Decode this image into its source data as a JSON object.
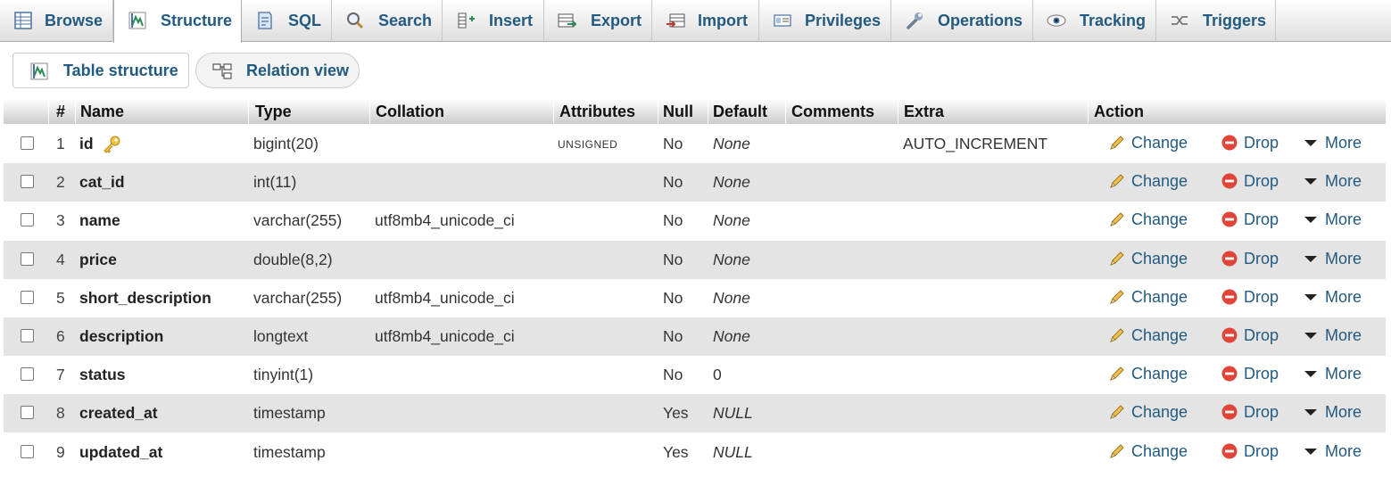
{
  "tabs": [
    {
      "id": "browse",
      "label": "Browse",
      "icon": "browse-icon"
    },
    {
      "id": "structure",
      "label": "Structure",
      "icon": "structure-icon",
      "active": true
    },
    {
      "id": "sql",
      "label": "SQL",
      "icon": "sql-icon"
    },
    {
      "id": "search",
      "label": "Search",
      "icon": "search-icon"
    },
    {
      "id": "insert",
      "label": "Insert",
      "icon": "insert-icon"
    },
    {
      "id": "export",
      "label": "Export",
      "icon": "export-icon"
    },
    {
      "id": "import",
      "label": "Import",
      "icon": "import-icon"
    },
    {
      "id": "privileges",
      "label": "Privileges",
      "icon": "privileges-icon"
    },
    {
      "id": "operations",
      "label": "Operations",
      "icon": "wrench-icon"
    },
    {
      "id": "tracking",
      "label": "Tracking",
      "icon": "eye-icon"
    },
    {
      "id": "triggers",
      "label": "Triggers",
      "icon": "triggers-icon"
    }
  ],
  "subnav": {
    "table_structure": "Table structure",
    "relation_view": "Relation view"
  },
  "columns": {
    "num": "#",
    "name": "Name",
    "type": "Type",
    "collation": "Collation",
    "attributes": "Attributes",
    "null": "Null",
    "default": "Default",
    "comments": "Comments",
    "extra": "Extra",
    "action": "Action"
  },
  "actions": {
    "change": "Change",
    "drop": "Drop",
    "more": "More"
  },
  "rows": [
    {
      "num": "1",
      "name": "id",
      "type": "bigint(20)",
      "collation": "",
      "attributes": "UNSIGNED",
      "null": "No",
      "default": "None",
      "extra": "AUTO_INCREMENT",
      "primary_key": true
    },
    {
      "num": "2",
      "name": "cat_id",
      "type": "int(11)",
      "collation": "",
      "attributes": "",
      "null": "No",
      "default": "None",
      "extra": ""
    },
    {
      "num": "3",
      "name": "name",
      "type": "varchar(255)",
      "collation": "utf8mb4_unicode_ci",
      "attributes": "",
      "null": "No",
      "default": "None",
      "extra": ""
    },
    {
      "num": "4",
      "name": "price",
      "type": "double(8,2)",
      "collation": "",
      "attributes": "",
      "null": "No",
      "default": "None",
      "extra": ""
    },
    {
      "num": "5",
      "name": "short_description",
      "type": "varchar(255)",
      "collation": "utf8mb4_unicode_ci",
      "attributes": "",
      "null": "No",
      "default": "None",
      "extra": ""
    },
    {
      "num": "6",
      "name": "description",
      "type": "longtext",
      "collation": "utf8mb4_unicode_ci",
      "attributes": "",
      "null": "No",
      "default": "None",
      "extra": ""
    },
    {
      "num": "7",
      "name": "status",
      "type": "tinyint(1)",
      "collation": "",
      "attributes": "",
      "null": "No",
      "default": "0",
      "extra": ""
    },
    {
      "num": "8",
      "name": "created_at",
      "type": "timestamp",
      "collation": "",
      "attributes": "",
      "null": "Yes",
      "default": "NULL",
      "extra": ""
    },
    {
      "num": "9",
      "name": "updated_at",
      "type": "timestamp",
      "collation": "",
      "attributes": "",
      "null": "Yes",
      "default": "NULL",
      "extra": ""
    }
  ],
  "colors": {
    "link": "#235a81",
    "row_alt": "#e4e4e4",
    "drop": "#e0453a",
    "key": "#e2b53a"
  }
}
